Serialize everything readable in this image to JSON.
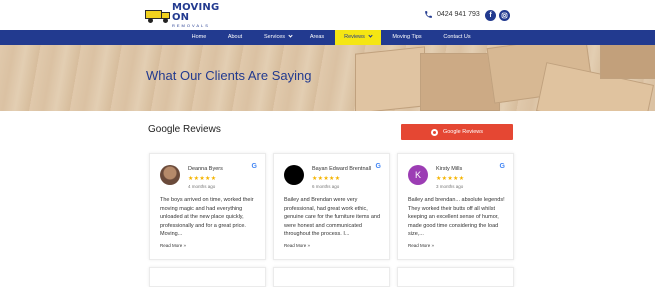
{
  "header": {
    "logo_main": "MOVING ON",
    "logo_sub": "REMOVALS",
    "phone": "0424 941 793",
    "social": [
      {
        "label": "f",
        "icon": "facebook-icon"
      },
      {
        "label": "IG",
        "icon": "instagram-icon"
      }
    ]
  },
  "nav": {
    "items": [
      {
        "label": "Home"
      },
      {
        "label": "About"
      },
      {
        "label": "Services"
      },
      {
        "label": "Areas"
      },
      {
        "label": "Reviews"
      },
      {
        "label": "Moving Tips"
      },
      {
        "label": "Contact Us"
      }
    ],
    "active_color": "#f5e613",
    "bar_color": "#223a8f"
  },
  "hero": {
    "title": "What Our Clients Are Saying"
  },
  "reviews": {
    "title": "Google Reviews",
    "button_label": "Google Reviews",
    "read_more": "Read More »",
    "cards": [
      {
        "name": "Deanna Byers",
        "stars": "★★★★★",
        "time": "4 months ago",
        "avatar_letter": "",
        "text": "The boys arrived on time, worked their moving magic and had everything unloaded at the new place quickly, professionally and for a great price. Moving..."
      },
      {
        "name": "Bayan Edward Brentnall",
        "stars": "★★★★★",
        "time": "6 months ago",
        "avatar_letter": "",
        "text": "Bailey and Brendan were very professional, had great work ethic, genuine care for the furniture items and were honest and communicated throughout the process. I..."
      },
      {
        "name": "Kirsty Mills",
        "stars": "★★★★★",
        "time": "3 months ago",
        "avatar_letter": "K",
        "text": "Bailey and brendan... absolute legends! They worked their butts off all whilst keeping an excellent sense of humor, made good time considering the load size,..."
      }
    ]
  }
}
